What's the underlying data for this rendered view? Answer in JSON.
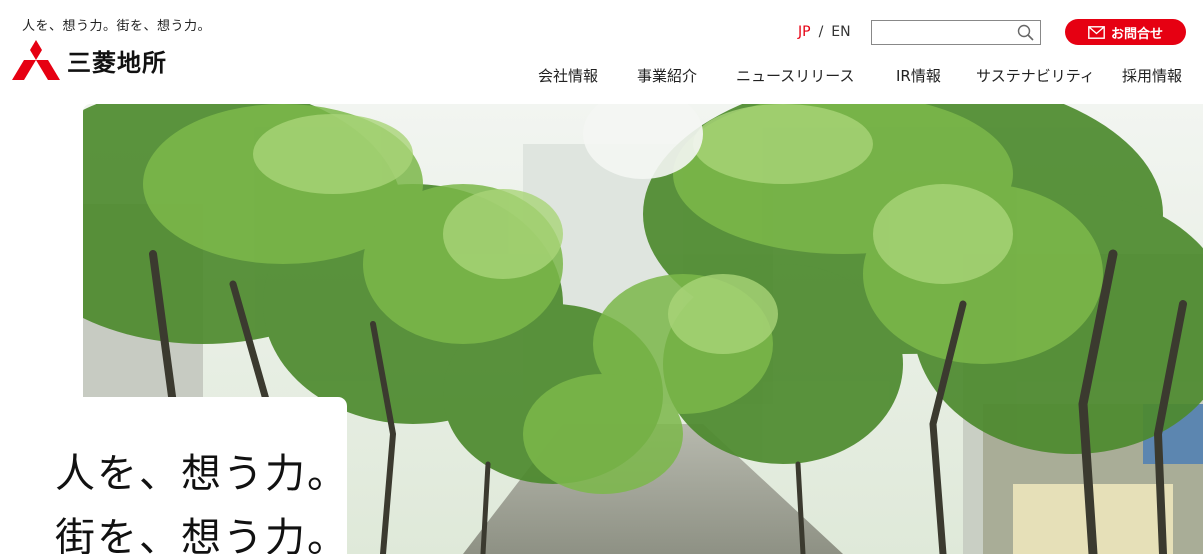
{
  "header": {
    "tagline": "人を、想う力。街を、想う力。",
    "logo_text": "三菱地所",
    "lang_jp": "JP",
    "lang_sep": "/",
    "lang_en": "EN",
    "search_placeholder": "",
    "contact_label": "お問合せ"
  },
  "nav": {
    "items": [
      "会社情報",
      "事業紹介",
      "ニュースリリース",
      "IR情報",
      "サステナビリティ",
      "採用情報"
    ]
  },
  "hero": {
    "copy_line1": "人を、想う力。",
    "copy_line2": "街を、想う力。"
  },
  "colors": {
    "brand_red": "#e60012",
    "foliage": "#5f9a3a"
  },
  "icons": {
    "logo": "three-diamonds-icon",
    "search": "search-icon",
    "contact": "mail-icon"
  }
}
